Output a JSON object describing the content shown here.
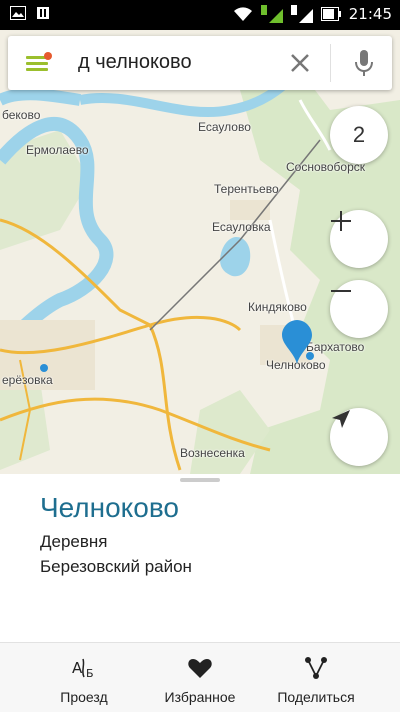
{
  "status_bar": {
    "time": "21:45"
  },
  "search": {
    "query": "д челноково"
  },
  "map": {
    "zoom_badge": "2",
    "places": [
      {
        "name": "беково"
      },
      {
        "name": "Есаулово"
      },
      {
        "name": "Ермолаево"
      },
      {
        "name": "Сосновоборск"
      },
      {
        "name": "Терентьево"
      },
      {
        "name": "Есауловка"
      },
      {
        "name": "Киндяково"
      },
      {
        "name": "Бархатово"
      },
      {
        "name": "Челноково"
      },
      {
        "name": "ерёзовка"
      },
      {
        "name": "Вознесенка"
      }
    ]
  },
  "place_card": {
    "title": "Челноково",
    "type": "Деревня",
    "region": "Березовский район"
  },
  "actions": [
    {
      "label": "Проезд"
    },
    {
      "label": "Избранное"
    },
    {
      "label": "Поделиться"
    }
  ]
}
